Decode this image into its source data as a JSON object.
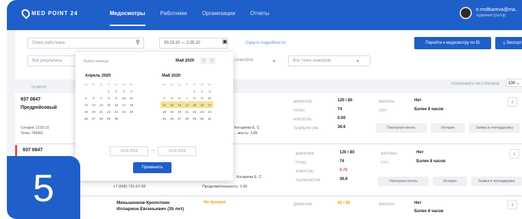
{
  "nav": {
    "logo": "MED  POINT 24",
    "items": [
      "Медосмотры",
      "Работники",
      "Организации",
      "Отчеты"
    ],
    "user_email": "e.moltkareva@ma..",
    "user_role": "Администратор"
  },
  "filters": {
    "search_placeholder": "Поиск работника",
    "date_range": "30.03.20 — 2.05.20",
    "hide_details": "Скрыть подробности",
    "goto_button": "Перейти к медосмотру по ID",
    "export_button": "Экспорт",
    "results_placeholder": "Все результаты",
    "point_select": "Все точки осмотров",
    "third_select": "...осмотров",
    "sort_label": "ОСМОТР",
    "per_page_label": "ПОКАЗЫВАТЬ НА СТРАНИЦЕ",
    "per_page_value": "100"
  },
  "calendar": {
    "header": "Выбор периода",
    "month_right_nav": "Май 2020",
    "left_month": "Апрель 2020",
    "right_month": "Май 2020",
    "weekdays": [
      "пн",
      "вт",
      "ср",
      "чт",
      "пт",
      "сб",
      "вс"
    ],
    "left_days": [
      "",
      "",
      "",
      "1",
      "2",
      "3",
      "4",
      "5",
      "6",
      "7",
      "8",
      "9",
      "10",
      "11",
      "12",
      "13",
      "14",
      "15",
      "16",
      "17",
      "18",
      "19",
      "20",
      "21",
      "22",
      "23",
      "24",
      "25",
      "26",
      "27",
      "28",
      "29",
      "30"
    ],
    "right_days": [
      "",
      "",
      "",
      "",
      "1",
      "2",
      "3",
      "4",
      "5",
      "6",
      "7",
      "8",
      "9",
      "10",
      "11",
      "12",
      "13",
      "14",
      "15",
      "16",
      "17",
      "18",
      "19",
      "20",
      "21",
      "22",
      "23",
      "24",
      "25",
      "26",
      "27",
      "28",
      "29",
      "30",
      "31"
    ],
    "date_from": "14.01.2019",
    "date_to": "14.01.2019",
    "apply_button": "Применить"
  },
  "cards": [
    {
      "id": "937 0847",
      "type": "Предрейсовый",
      "date": "Сегодня, 13:02:15",
      "point": "Точка: 765492",
      "medic": "Косарева Е. С.",
      "validity": "...мость: 1:05",
      "pressure_label": "ДАВЛЕНИЕ",
      "pressure": "120 / 80",
      "pulse_label": "ПУЛЬС",
      "pulse": "74",
      "alcohol_label": "АЛКОГОЛЬ",
      "alcohol": "0.00",
      "temp_label": "ТЕМПЕРАТУРА",
      "temp": "36.6",
      "complaints_label": "ЖАЛОБЫ",
      "complaints": "Нет",
      "sleep_label": "СОН",
      "sleep": "Более 8 часов",
      "reprint": "Повторная печать",
      "history": "История",
      "support": "Заявка в техподдержку"
    },
    {
      "id": "937 0847",
      "type": "",
      "date": "",
      "point": "",
      "phone": "+7 (905) 731-57-63",
      "medic": "Косарева Е. С.",
      "validity": "Продолжительность: 1:05",
      "pressure_label": "ДАВЛЕНИЕ",
      "pressure": "120 / 80",
      "pulse_label": "ПУЛЬС",
      "pulse": "74",
      "alcohol_label": "АЛКОГОЛЬ",
      "alcohol": "0.70",
      "temp_label": "ТЕМПЕРАТУРА",
      "temp": "36.6",
      "complaints_label": "ЖАЛОБЫ",
      "complaints": "Нет",
      "sleep_label": "СОН",
      "sleep": "Более 8 часов",
      "reprint": "Повторная печать",
      "history": "История",
      "support": "Заявка в техподдержку"
    },
    {
      "name_line1": "Меньшенков-Кропоткин",
      "name_line2": "Илларион Евгеньевич (35 лет)",
      "status": "Не прошел",
      "pressure_label": "ДАВЛЕНИЕ",
      "pressure": "95 / 80",
      "complaints_label": "ЖАЛОБЫ",
      "complaints": "Нет",
      "sleep": "Более 8 часов"
    }
  ],
  "badge": "5"
}
